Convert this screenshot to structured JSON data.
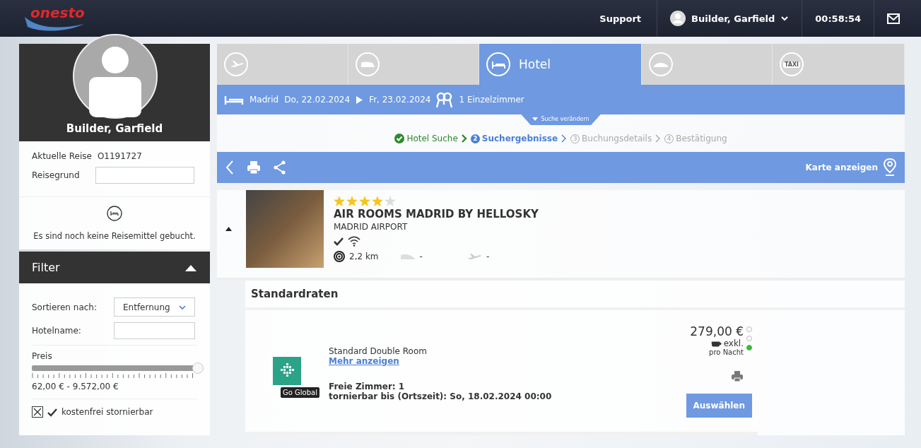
{
  "header": {
    "logo": "onesto",
    "support": "Support",
    "user": "Builder, Garfield",
    "timer": "00:58:54"
  },
  "profile": {
    "name": "Builder, Garfield",
    "trip_label": "Aktuelle Reise",
    "trip_id": "O1191727",
    "reason_label": "Reisegrund",
    "empty_message": "Es sind noch keine Reisemittel gebucht."
  },
  "filter": {
    "title": "Filter",
    "expanded": true,
    "sort_label": "Sortieren nach:",
    "sort_value": "Entfernung",
    "name_label": "Hotelname:",
    "price_label": "Preis",
    "level": 1,
    "price_range": "62,00 € -  9.572,00 €",
    "free_cancel": {
      "label": "kostenfrei stornierbar",
      "checked": true
    }
  },
  "tabs": [
    {
      "kind": "flight",
      "selected": false
    },
    {
      "kind": "train",
      "selected": false
    },
    {
      "kind": "hotel",
      "label": "Hotel",
      "selected": true
    },
    {
      "kind": "car",
      "selected": false
    },
    {
      "kind": "taxi",
      "badge": "TAXI",
      "selected": false
    }
  ],
  "search_summary": {
    "city": "Madrid",
    "from": "Do, 22.02.2024",
    "to": "Fr, 23.02.2024",
    "rooms": "1 Einzelzimmer",
    "modify": "Suche verändern"
  },
  "steps": [
    {
      "label": "Hotel Suche",
      "done": true,
      "selected": false
    },
    {
      "number": "2",
      "label": "Suchergebnisse",
      "done": false,
      "selected": true
    },
    {
      "number": "3",
      "label": "Buchungsdetails",
      "done": false,
      "selected": false
    },
    {
      "number": "4",
      "label": "Bestätigung",
      "done": false,
      "selected": false
    }
  ],
  "toolbar": {
    "map": "Karte anzeigen"
  },
  "hotel": {
    "stars": 4,
    "name": "AIR ROOMS MADRID BY HELLOSKY",
    "area": "MADRID AIRPORT",
    "expanded": true,
    "distance": "2,2 km",
    "train": "-",
    "flight": "-"
  },
  "rates": {
    "title": "Standardraten",
    "items": [
      {
        "provider": "Go Global",
        "room": "Standard Double Room",
        "more": "Mehr anzeigen",
        "free_rooms": "Freie Zimmer: 1",
        "cancel": "tornierbar bis (Ortszeit): So, 18.02.2024 00:00",
        "price": "279,00 €",
        "breakfast": "exkl.",
        "per_night": "pro Nacht",
        "select": "Auswählen",
        "lights": [
          {
            "on": false
          },
          {
            "on": false
          },
          {
            "on": true
          }
        ]
      }
    ]
  }
}
